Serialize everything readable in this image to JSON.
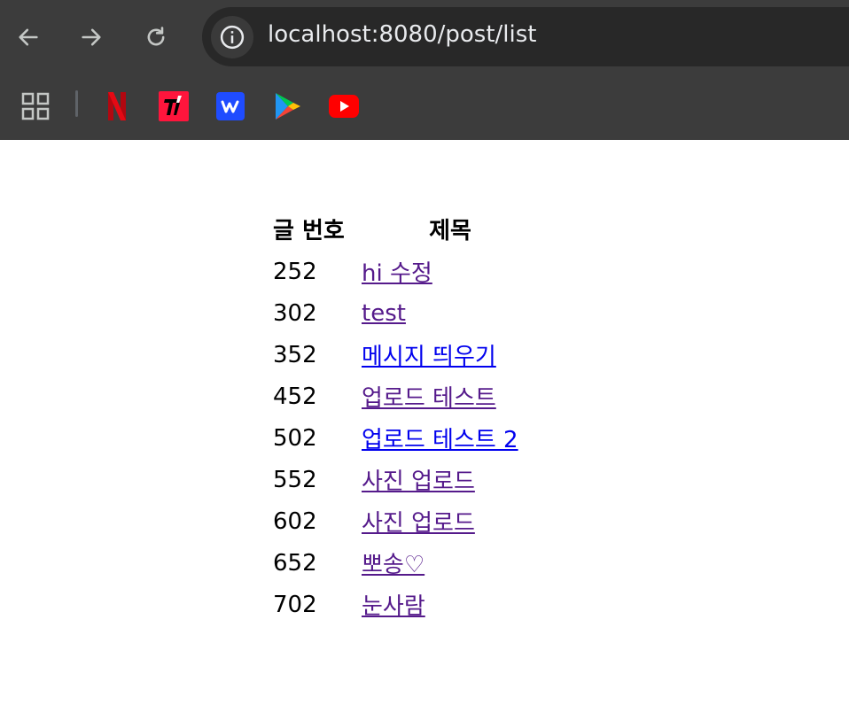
{
  "browser": {
    "url": "localhost:8080/post/list",
    "bookmarks": [
      {
        "name": "apps",
        "icon": "apps-grid-icon"
      },
      {
        "name": "netflix",
        "icon": "netflix-icon",
        "color": "#b20710"
      },
      {
        "name": "tving",
        "icon": "tving-icon",
        "color": "#ff153c"
      },
      {
        "name": "wavve",
        "icon": "wavve-icon",
        "color": "#1f4cff"
      },
      {
        "name": "google-play",
        "icon": "google-play-icon"
      },
      {
        "name": "youtube",
        "icon": "youtube-icon",
        "color": "#ff0000"
      }
    ]
  },
  "table": {
    "headers": {
      "number": "글 번호",
      "title": "제목"
    },
    "rows": [
      {
        "id": "252",
        "title": "hi 수정",
        "visited": true
      },
      {
        "id": "302",
        "title": "test",
        "visited": true
      },
      {
        "id": "352",
        "title": "메시지 띄우기",
        "visited": false
      },
      {
        "id": "452",
        "title": "업로드 테스트",
        "visited": true
      },
      {
        "id": "502",
        "title": "업로드 테스트 2",
        "visited": false
      },
      {
        "id": "552",
        "title": "사진 업로드",
        "visited": true
      },
      {
        "id": "602",
        "title": "사진 업로드",
        "visited": true
      },
      {
        "id": "652",
        "title": "뽀송♡",
        "visited": true
      },
      {
        "id": "702",
        "title": "눈사람",
        "visited": true
      }
    ]
  },
  "colors": {
    "visited_link": "#551a8b",
    "unvisited_link": "#0000ee",
    "chrome_bg": "#3c3c3c"
  }
}
